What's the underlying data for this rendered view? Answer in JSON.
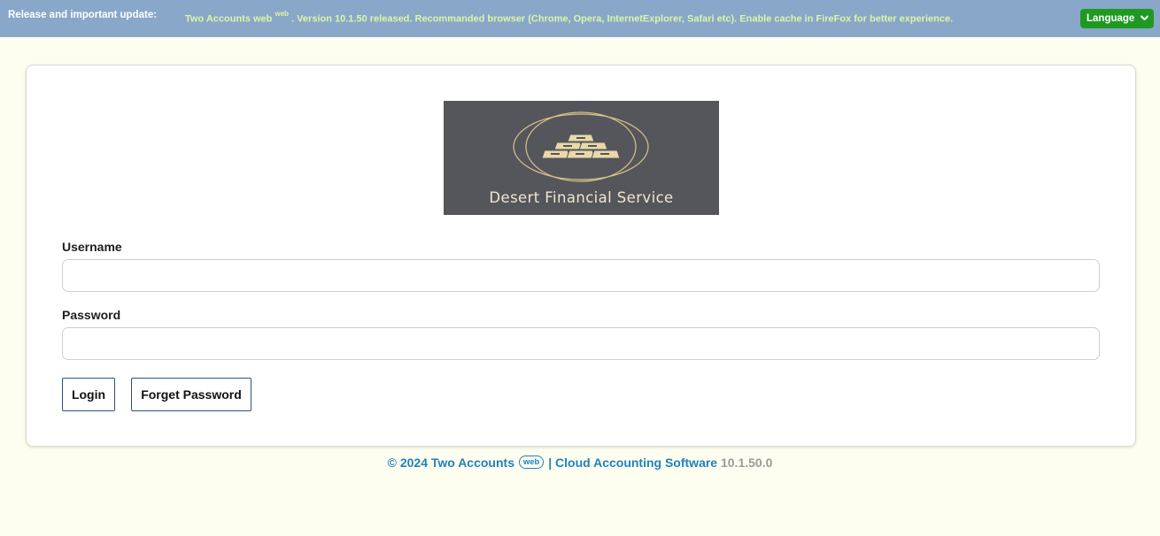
{
  "topbar": {
    "label": "Release and important update:",
    "message_prefix": "Two Accounts web",
    "message_sup": "web",
    "message_rest": ". Version 10.1.50 released. Recommanded browser (Chrome, Opera, InternetExplorer, Safari etc). Enable cache in FireFox for better experience.",
    "language_button": "Language",
    "language_icon": "chevron-down-icon",
    "bg_color": "#88a7c9",
    "message_color": "#dcf5a6",
    "button_color": "#1f9922"
  },
  "logo": {
    "text": "Desert Financial Service",
    "bg_color": "#55565c",
    "accent_color": "#d9c38a"
  },
  "form": {
    "username_label": "Username",
    "username_value": "",
    "password_label": "Password",
    "password_value": "",
    "login_button": "Login",
    "forget_button": "Forget Password"
  },
  "footer": {
    "copyright": "© 2024 Two Accounts",
    "badge": "web",
    "product": "| Cloud Accounting Software",
    "version": "10.1.50.0",
    "color": "#1f82c0"
  }
}
